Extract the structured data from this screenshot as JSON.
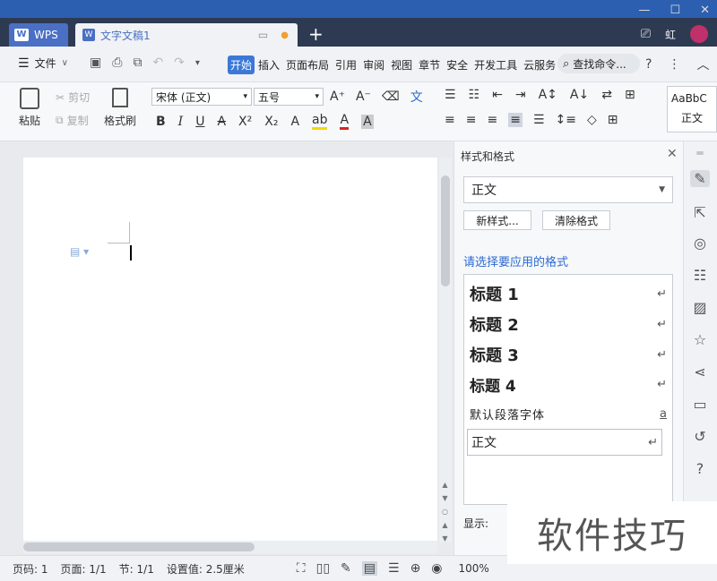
{
  "tabs": {
    "home": "WPS",
    "doc": "文字文稿1",
    "new_tab": "+"
  },
  "title_right": {
    "tablet": "⎚",
    "user": "虹"
  },
  "window_controls": {
    "min": "—",
    "max": "☐",
    "close": "✕"
  },
  "menu": {
    "file_label": "文件",
    "items": [
      "开始",
      "插入",
      "页面布局",
      "引用",
      "审阅",
      "视图",
      "章节",
      "安全",
      "开发工具",
      "云服务"
    ],
    "search": "查找命令...",
    "help": "?",
    "more": "⋮",
    "collapse": "︿"
  },
  "ribbon": {
    "paste": "粘贴",
    "cut": "剪切",
    "copy": "复制",
    "format_painter": "格式刷",
    "font_name": "宋体 (正文)",
    "font_size": "五号",
    "style_preview": "AaBbC",
    "style_preview_name": "正文"
  },
  "styles_panel": {
    "title": "样式和格式",
    "current_style": "正文",
    "new_style": "新样式...",
    "clear_format": "清除格式",
    "apply_label": "请选择要应用的格式",
    "styles": [
      {
        "name": "标题  1",
        "mark": "↵"
      },
      {
        "name": "标题  2",
        "mark": "↵"
      },
      {
        "name": "标题  3",
        "mark": "↵"
      },
      {
        "name": "标题  4",
        "mark": "↵"
      },
      {
        "name": "默认段落字体",
        "mark": "a"
      },
      {
        "name": "正文",
        "mark": "↵"
      }
    ],
    "show_label": "显示:"
  },
  "statusbar": {
    "page_no": "页码: 1",
    "pages": "页面: 1/1",
    "section": "节: 1/1",
    "setting": "设置值: 2.5厘米",
    "zoom": "100%"
  },
  "watermark": "软件技巧",
  "colors": {
    "accent": "#3c78d8",
    "titlebar": "#2d3a52",
    "link": "#2d6ad1"
  }
}
